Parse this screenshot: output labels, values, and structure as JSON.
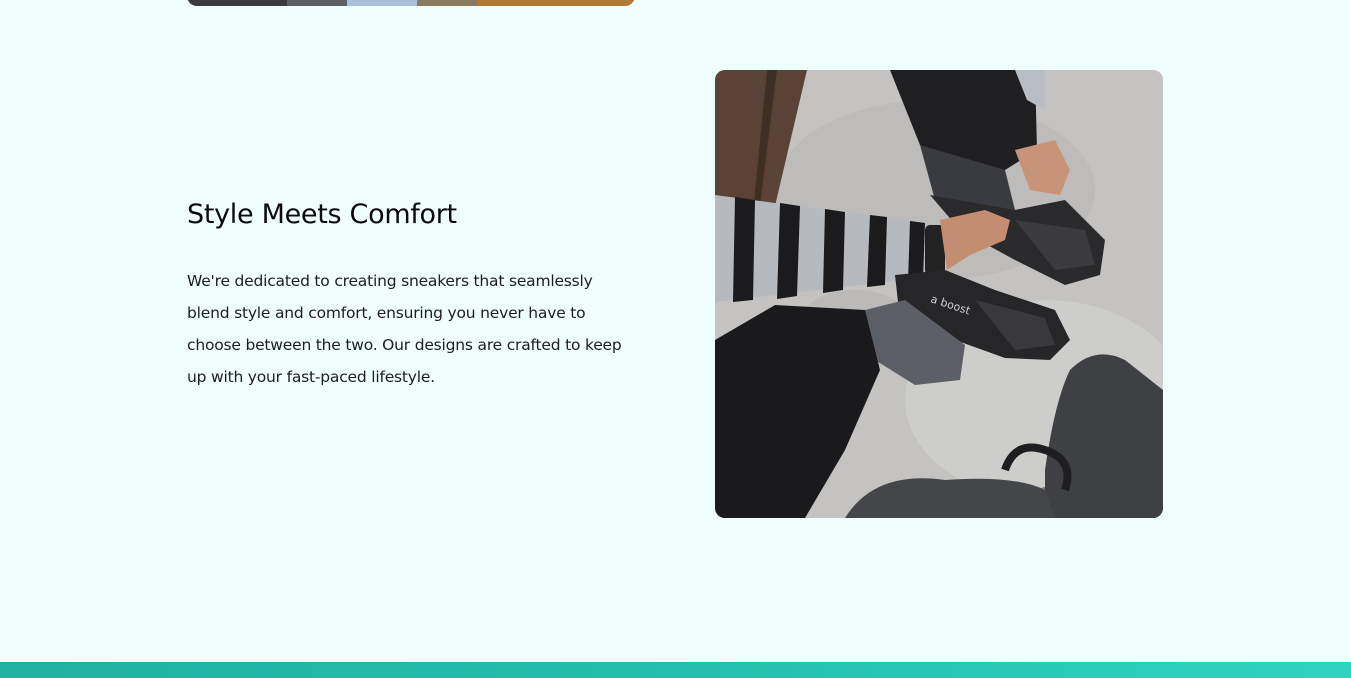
{
  "section": {
    "heading": "Style Meets Comfort",
    "body": "We're dedicated to creating sneakers that seamlessly blend style and comfort, ensuring you never have to choose between the two. Our designs are crafted to keep up with your fast-paced lifestyle.",
    "photo_icon": "sneakers-photo",
    "shoe_text": "a boost"
  },
  "colors": {
    "background": "#effffe",
    "footer_start": "#1fb1a2",
    "footer_end": "#2fd3c0",
    "text": "#0a0a0a"
  }
}
